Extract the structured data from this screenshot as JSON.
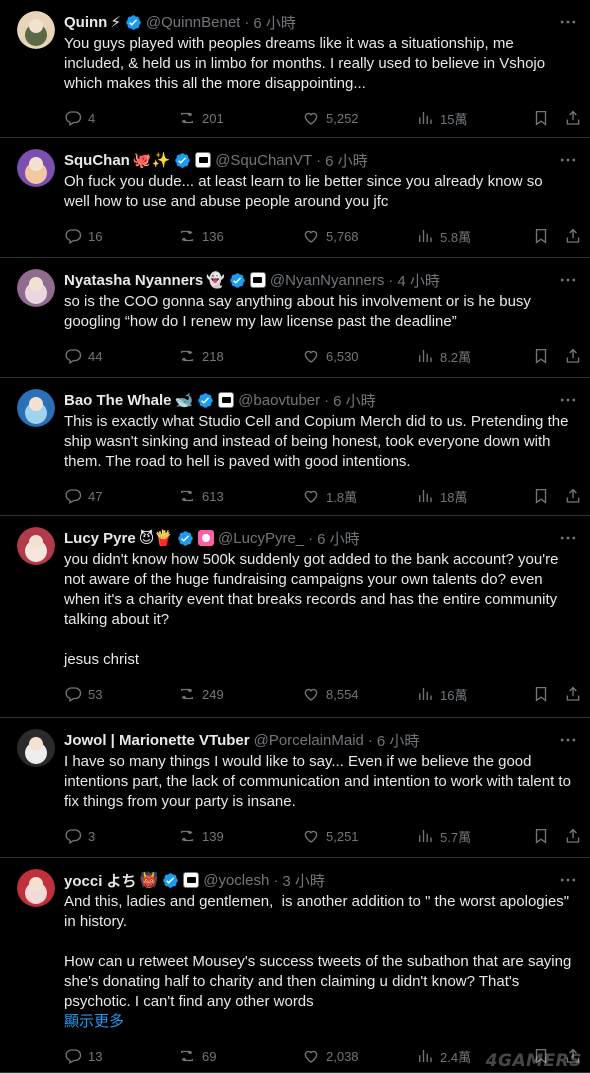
{
  "colors": {
    "background": "#000000",
    "text": "#e7e9ea",
    "muted": "#71767b",
    "verified": "#1d9bf0",
    "link": "#1d9bf0"
  },
  "tweets": [
    {
      "name": "Quinn",
      "emoji": "⚡",
      "badge": "verified",
      "affiliate": false,
      "handle": "@QuinnBenet",
      "time": "6 小時",
      "text": [
        "You guys played with peoples dreams like it was a situationship, me included, & held us in limbo for months. I really used to believe in Vshojo which makes this all the more disappointing..."
      ],
      "show_more": "",
      "replies": "4",
      "reposts": "201",
      "likes": "5,252",
      "views": "15萬",
      "avatar_colors": [
        "#5b6b47",
        "#e8d4b8"
      ]
    },
    {
      "name": "SquChan",
      "emoji": "🐙✨",
      "badge": "verified",
      "affiliate": true,
      "handle": "@SquChanVT",
      "time": "6 小時",
      "text": [
        "Oh fuck you dude... at least learn to lie better since you already know so well how to use and abuse people around you jfc"
      ],
      "show_more": "",
      "replies": "16",
      "reposts": "136",
      "likes": "5,768",
      "views": "5.8萬",
      "avatar_colors": [
        "#f2c8a0",
        "#7a4fb0"
      ]
    },
    {
      "name": "Nyatasha Nyanners",
      "emoji": "👻",
      "badge": "verified",
      "affiliate": true,
      "handle": "@NyanNyanners",
      "time": "4 小時",
      "text": [
        "so is the COO gonna say anything about his involvement or is he busy googling “how do I renew my law license past the deadline”"
      ],
      "show_more": "",
      "replies": "44",
      "reposts": "218",
      "likes": "6,530",
      "views": "8.2萬",
      "avatar_colors": [
        "#e9d7df",
        "#8e6b8f"
      ]
    },
    {
      "name": "Bao The Whale",
      "emoji": "🐋",
      "badge": "verified",
      "affiliate": true,
      "handle": "@baovtuber",
      "time": "6 小時",
      "text": [
        "This is exactly what Studio Cell and Copium Merch did to us. Pretending the ship wasn't sinking and instead of being honest, took everyone down with them. The road to hell is paved with good intentions."
      ],
      "show_more": "",
      "replies": "47",
      "reposts": "613",
      "likes": "1.8萬",
      "views": "18萬",
      "avatar_colors": [
        "#9fd3f0",
        "#2b6fb6"
      ]
    },
    {
      "name": "Lucy Pyre",
      "emoji": "😈🍟",
      "badge": "verified",
      "affiliate": "pink",
      "handle": "@LucyPyre_",
      "time": "6 小時",
      "text": [
        "you didn't know how 500k suddenly got added to the bank account? you're not aware of the huge fundraising campaigns your own talents do? even when it's a charity event that breaks records and has the entire community talking about it?",
        "jesus christ"
      ],
      "show_more": "",
      "replies": "53",
      "reposts": "249",
      "likes": "8,554",
      "views": "16萬",
      "avatar_colors": [
        "#f5e6e0",
        "#b23a4a"
      ]
    },
    {
      "name": "Jowol | Marionette VTuber",
      "emoji": "",
      "badge": "",
      "affiliate": false,
      "handle": "@PorcelainMaid",
      "time": "6 小時",
      "text": [
        "I have so many things I would like to say... Even if we believe the good intentions part, the lack of communication and intention to work with talent to fix things from your party is insane."
      ],
      "show_more": "",
      "replies": "3",
      "reposts": "139",
      "likes": "5,251",
      "views": "5.7萬",
      "avatar_colors": [
        "#eeeeee",
        "#2a2a2a"
      ]
    },
    {
      "name": "yocci よち",
      "emoji": "👹",
      "badge": "verified",
      "affiliate": true,
      "handle": "@yoclesh",
      "time": "3 小時",
      "text": [
        "And this, ladies and gentlemen,  is another addition to \" the worst apologies\" in history.",
        "How can u retweet Mousey's success tweets of the subathon that are saying she's donating half to charity and then claiming u didn't know? That's psychotic. I can't find any other words"
      ],
      "show_more": "顯示更多",
      "replies": "13",
      "reposts": "69",
      "likes": "2,038",
      "views": "2.4萬",
      "avatar_colors": [
        "#f3d9d9",
        "#c0303a"
      ]
    }
  ],
  "watermark": "4GAMERS"
}
